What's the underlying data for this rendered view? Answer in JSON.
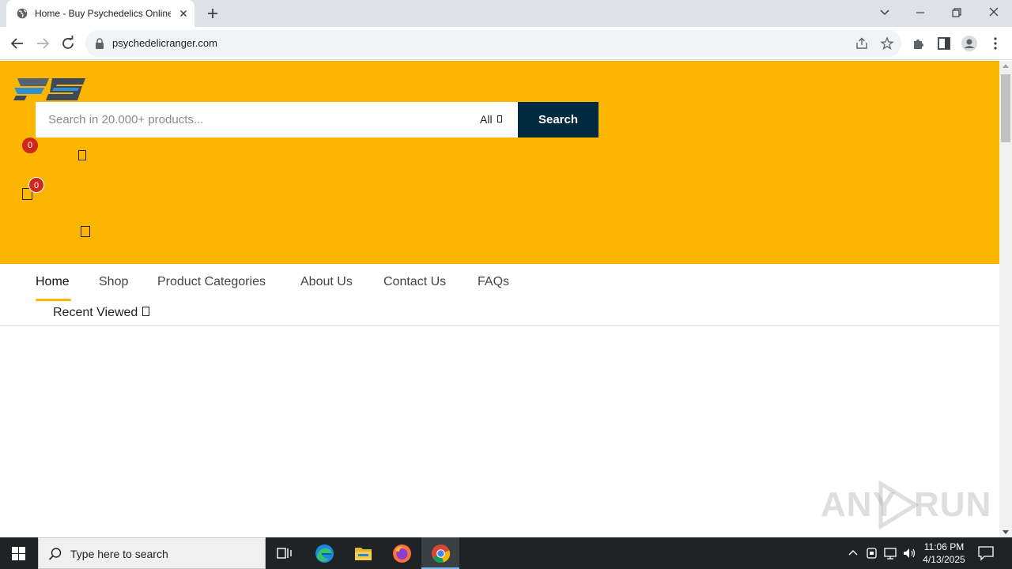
{
  "browser": {
    "tab_title": "Home - Buy Psychedelics Online",
    "url": "psychedelicranger.com"
  },
  "site": {
    "logo_text": "PS",
    "search": {
      "placeholder": "Search in 20.000+ products...",
      "category": "All",
      "button_label": "Search"
    },
    "wishlist_count": "0",
    "cart_count": "0",
    "nav": {
      "items": [
        "Home",
        "Shop",
        "Product Categories",
        "About Us",
        "Contact Us",
        "FAQs"
      ],
      "active": "Home",
      "recent_viewed": "Recent Viewed"
    },
    "colors": {
      "header_bg": "#fcb600",
      "search_button_bg": "#002a40",
      "badge_bg": "#d0271d"
    }
  },
  "watermark": {
    "text_left": "ANY",
    "text_right": "RUN"
  },
  "taskbar": {
    "search_placeholder": "Type here to search",
    "time": "11:06 PM",
    "date": "4/13/2025",
    "apps": [
      "task-view",
      "edge",
      "file-explorer",
      "firefox",
      "chrome"
    ]
  }
}
